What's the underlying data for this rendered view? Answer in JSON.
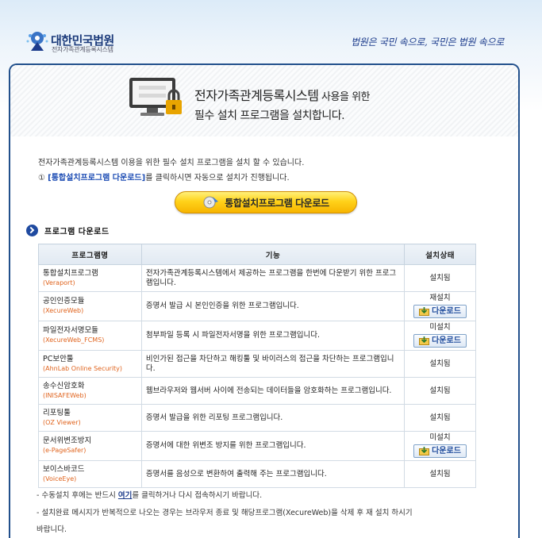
{
  "header": {
    "court_name": "대한민국법원",
    "court_sub": "전자가족관계등록시스템",
    "slogan": "법원은 국민 속으로, 국민은 법원 속으로"
  },
  "banner": {
    "title_main": "전자가족관계등록시스템",
    "title_suffix": " 사용을 위한",
    "title_line2": "필수 설치 프로그램을 설치합니다."
  },
  "intro": {
    "line1": "전자가족관계등록시스템 이용을 위한 필수 설치 프로그램을 설치 할 수 있습니다.",
    "line2_prefix": "① ",
    "line2_link": "[통합설치프로그램 다운로드]",
    "line2_suffix": "를 클릭하시면 자동으로 설치가 진행됩니다."
  },
  "main_button": {
    "label": "통합설치프로그램 다운로드"
  },
  "section": {
    "title": "프로그램 다운로드"
  },
  "table": {
    "headers": [
      "프로그램명",
      "기능",
      "설치상태"
    ],
    "download_label": "다운로드",
    "rows": [
      {
        "name": "통합설치프로그램",
        "code": "(Veraport)",
        "func": "전자가족관계등록시스템에서 제공하는 프로그램을 한번에 다운받기 위한 프로그램입니다.",
        "status": "설치됨",
        "download": false
      },
      {
        "name": "공인인증모듈",
        "code": "(XecureWeb)",
        "func": "증명서 발급 시 본인인증을 위한 프로그램입니다.",
        "status": "재설치",
        "download": true
      },
      {
        "name": "파일전자서명모듈",
        "code": "(XecureWeb_FCMS)",
        "func": "첨부파일 등록 시 파일전자서명을 위한 프로그램입니다.",
        "status": "미설치",
        "download": true
      },
      {
        "name": "PC보안툴",
        "code": "(AhnLab Online Security)",
        "func": "비인가된 접근을 차단하고 해킹툴 및 바이러스의 접근을 차단하는 프로그램입니다.",
        "status": "설치됨",
        "download": false
      },
      {
        "name": "송수신암호화",
        "code": "(INISAFEWeb)",
        "func": "웹브라우저와 웹서버 사이에 전송되는 데이터들을 암호화하는 프로그램입니다.",
        "status": "설치됨",
        "download": false
      },
      {
        "name": "리포팅툴",
        "code": "(OZ Viewer)",
        "func": "증명서 발급을 위한 리포팅 프로그램입니다.",
        "status": "설치됨",
        "download": false
      },
      {
        "name": "문서위변조방지",
        "code": "(e-PageSafer)",
        "func": "증명서에 대한 위변조 방지를 위한 프로그램입니다.",
        "status": "미설치",
        "download": true
      },
      {
        "name": "보이스바코드",
        "code": "(VoiceEye)",
        "func": "증명서를 음성으로 변환하여 출력해 주는 프로그램입니다.",
        "status": "설치됨",
        "download": false
      }
    ]
  },
  "notes": {
    "n1_prefix": "- 수동설치 후에는 반드시 ",
    "n1_link": "여기",
    "n1_suffix": "를 클릭하거나 다시 접속하시기 바랍니다.",
    "n2": "- 설치완료 메시지가 반복적으로 나오는 경우는 브라우저 종료 및 해당프로그램(XecureWeb)을 삭제 후 재 설치 하시기",
    "n3": "바랍니다."
  }
}
